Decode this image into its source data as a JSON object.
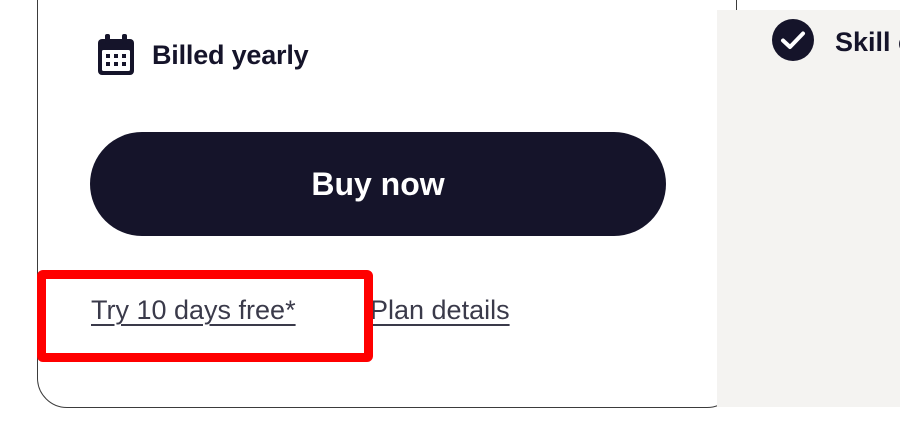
{
  "plan": {
    "billing_label": "Billed yearly",
    "billing_icon": "calendar-icon",
    "buy_button_label": "Buy now",
    "trial_link_label": "Try 10 days free*",
    "details_link_label": "Plan details"
  },
  "features": {
    "check_icon": "check-circle-icon",
    "item_text": "Skill certi"
  },
  "colors": {
    "primary": "#15142a",
    "highlight": "#ff0000",
    "panel_bg": "#f4f3f1"
  }
}
